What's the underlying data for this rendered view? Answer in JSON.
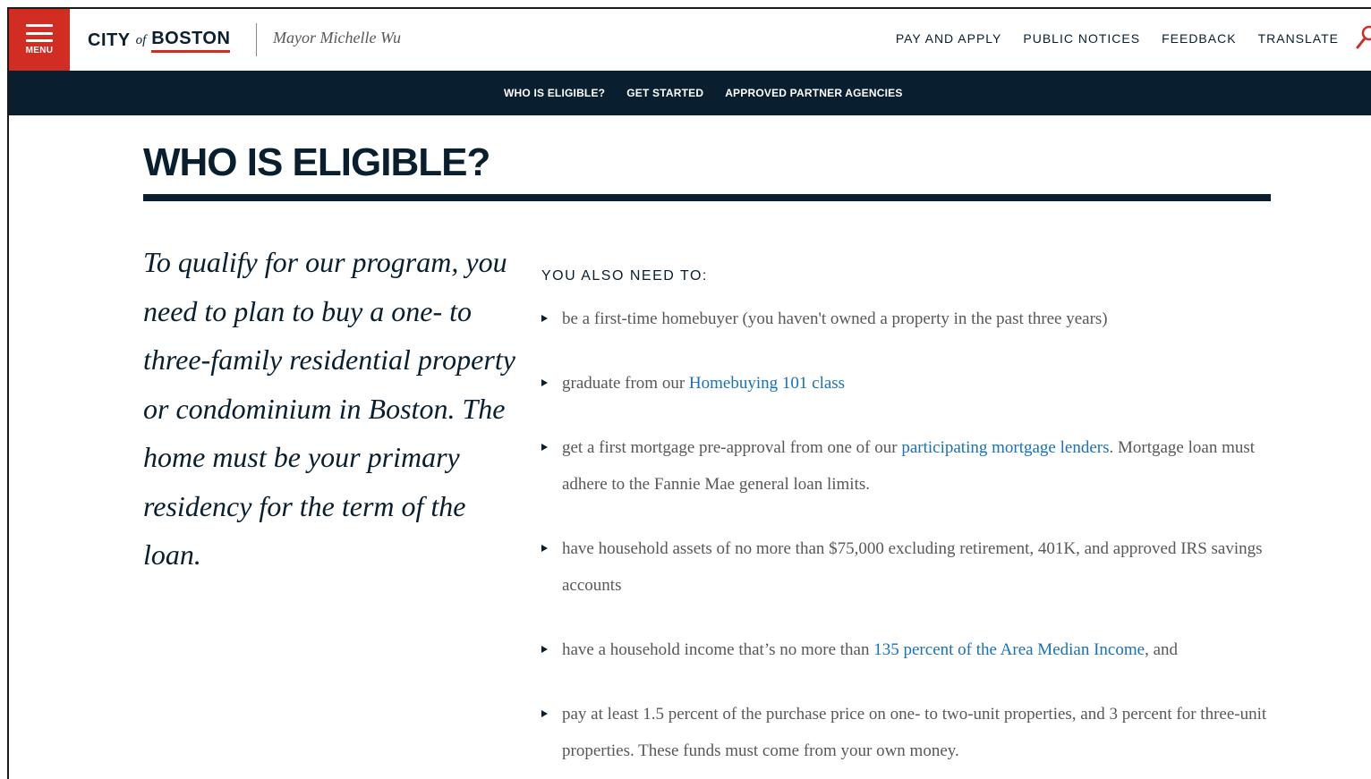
{
  "header": {
    "menu_label": "MENU",
    "logo": {
      "city": "CITY",
      "of": "of",
      "boston": "BOSTON"
    },
    "mayor": "Mayor Michelle Wu",
    "nav": [
      "PAY AND APPLY",
      "PUBLIC NOTICES",
      "FEEDBACK",
      "TRANSLATE"
    ]
  },
  "subnav": [
    "WHO IS ELIGIBLE?",
    "GET STARTED",
    "APPROVED PARTNER AGENCIES"
  ],
  "main": {
    "title": "WHO IS ELIGIBLE?",
    "intro": "To qualify for our program, you need to plan to buy a one- to three-family residential property or condominium in Boston. The home must be your primary residency for the term of the loan.",
    "requirements_heading": "YOU ALSO NEED TO:",
    "requirements": [
      {
        "text": "be a first-time homebuyer (you haven't owned a property in the past three years)"
      },
      {
        "before": "graduate from our ",
        "link": "Homebuying 101 class",
        "after": ""
      },
      {
        "before": "get a first mortgage pre-approval from one of our ",
        "link": "participating mortgage lenders",
        "after": ". Mortgage loan must adhere to the Fannie Mae general loan limits."
      },
      {
        "text": "have household assets of no more than $75,000 excluding retirement, 401K, and approved IRS savings accounts"
      },
      {
        "before": "have a household income that’s no more than ",
        "link": "135 percent of the Area Median Income",
        "after": ", and"
      },
      {
        "text": "pay at least 1.5 percent of the purchase price on one- to two-unit properties, and 3 percent for three-unit properties. These funds must come from your own money."
      }
    ]
  },
  "colors": {
    "brand_red": "#d22d23",
    "navy": "#091f2f",
    "link_blue": "#1871bd",
    "body_gray": "#58585b"
  }
}
